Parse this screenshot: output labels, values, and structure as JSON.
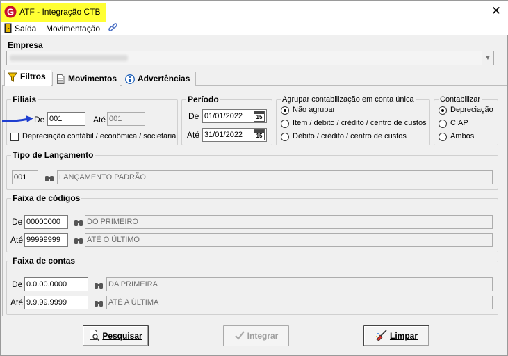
{
  "window": {
    "title": "ATF - Integração CTB",
    "close_glyph": "✕"
  },
  "menu": {
    "saida": "Saída",
    "movimentacao": "Movimentação"
  },
  "empresa": {
    "label": "Empresa"
  },
  "tabs": [
    {
      "label": "Filtros",
      "icon": "filter-icon"
    },
    {
      "label": "Movimentos",
      "icon": "document-icon"
    },
    {
      "label": "Advertências",
      "icon": "info-icon"
    }
  ],
  "filiais": {
    "title": "Filiais",
    "de_label": "De",
    "de_value": "001",
    "ate_label": "Até",
    "ate_value": "001",
    "depreciacao_label": "Depreciação contábil / econômica / societária"
  },
  "periodo": {
    "title": "Período",
    "de_label": "De",
    "de_value": "01/01/2022",
    "ate_label": "Até",
    "ate_value": "31/01/2022",
    "cal_glyph": "15"
  },
  "agrupar": {
    "title": "Agrupar contabilização em conta única",
    "options": [
      "Não agrupar",
      "Item / débito / crédito / centro de custos",
      "Débito / crédito / centro de custos"
    ],
    "selected": 0
  },
  "contabilizar": {
    "title": "Contabilizar",
    "options": [
      "Depreciação",
      "CIAP",
      "Ambos"
    ],
    "selected": 0
  },
  "tipo_lancamento": {
    "title": "Tipo de Lançamento",
    "code": "001",
    "description": "LANÇAMENTO PADRÃO"
  },
  "faixa_codigos": {
    "title": "Faixa de códigos",
    "de_label": "De",
    "de_value": "00000000",
    "de_desc": "DO PRIMEIRO",
    "ate_label": "Até",
    "ate_value": "99999999",
    "ate_desc": "ATÉ O ÚLTIMO"
  },
  "faixa_contas": {
    "title": "Faixa de contas",
    "de_label": "De",
    "de_value": "0.0.00.0000",
    "de_desc": "DA PRIMEIRA",
    "ate_label": "Até",
    "ate_value": "9.9.99.9999",
    "ate_desc": "ATÉ A ÚLTIMA"
  },
  "buttons": {
    "pesquisar": "Pesquisar",
    "integrar": "Integrar",
    "limpar": "Limpar"
  },
  "colors": {
    "title_highlight": "#ffff33",
    "annotation_arrow": "#1f3fd0",
    "app_icon": "#c8102e"
  }
}
